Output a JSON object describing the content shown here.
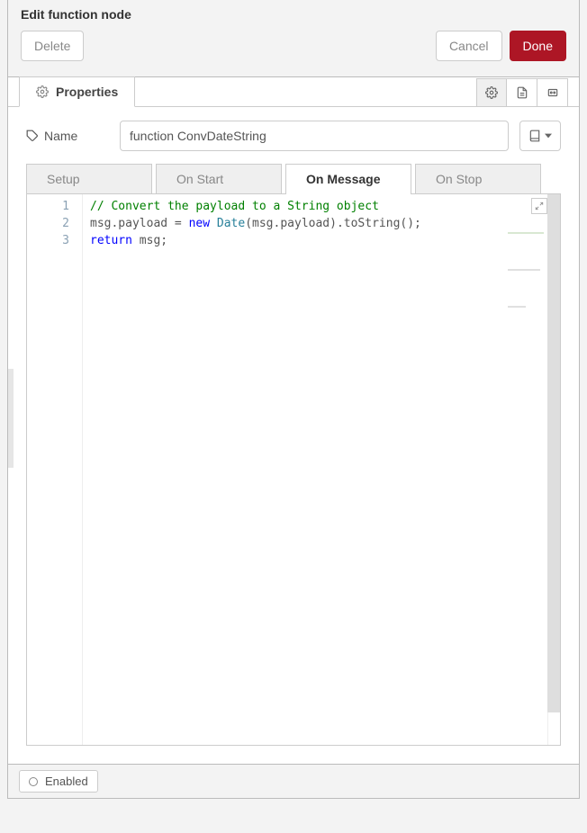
{
  "header": {
    "title": "Edit function node",
    "delete_label": "Delete",
    "cancel_label": "Cancel",
    "done_label": "Done"
  },
  "tabs": {
    "properties_label": "Properties"
  },
  "name": {
    "label": "Name",
    "value": "function ConvDateString"
  },
  "sub_tabs": {
    "0": {
      "label": "Setup"
    },
    "1": {
      "label": "On Start"
    },
    "2": {
      "label": "On Message"
    },
    "3": {
      "label": "On Stop"
    },
    "active_index": 2
  },
  "editor": {
    "line_numbers": [
      "1",
      "2",
      "3"
    ],
    "code": {
      "l1_comment": "// Convert the payload to a String object",
      "l2_a": "msg.payload = ",
      "l2_new": "new",
      "l2_sp": " ",
      "l2_date": "Date",
      "l2_b": "(msg.payload).toString();",
      "l3_return": "return",
      "l3_rest": " msg;"
    }
  },
  "footer": {
    "enabled_label": "Enabled"
  }
}
